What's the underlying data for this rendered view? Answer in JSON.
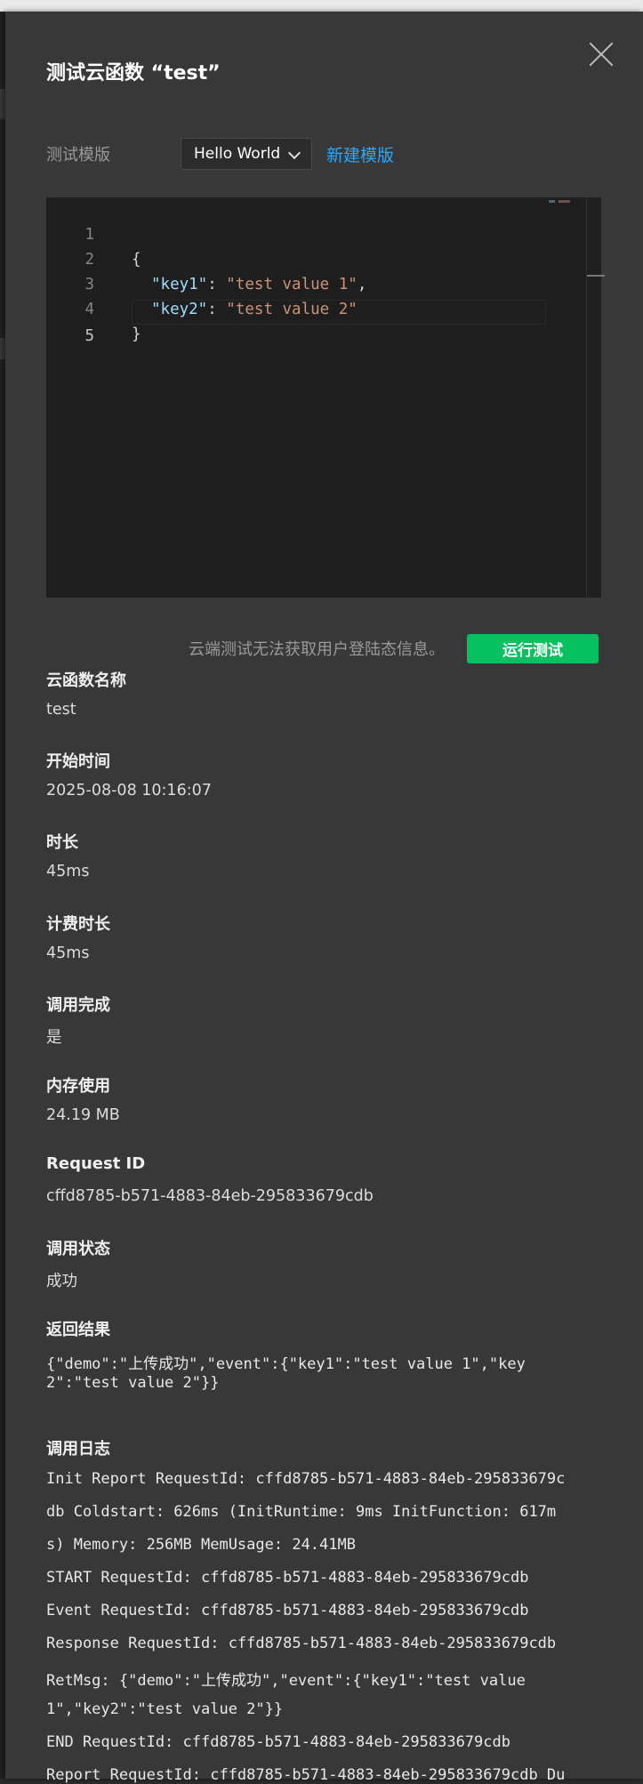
{
  "dialog": {
    "title": "测试云函数 “test”"
  },
  "template": {
    "label": "测试模版",
    "selected": "Hello World",
    "new_link": "新建模版"
  },
  "editor": {
    "lines": [
      {
        "number": "1",
        "parts": [
          "{"
        ]
      },
      {
        "number": "2",
        "parts": [
          "\"key1\"",
          ": ",
          "\"test value 1\"",
          ","
        ]
      },
      {
        "number": "3",
        "parts": [
          "\"key2\"",
          ": ",
          "\"test value 2\""
        ]
      },
      {
        "number": "4",
        "parts": [
          "}"
        ]
      },
      {
        "number": "5",
        "parts": [
          ""
        ]
      }
    ]
  },
  "run": {
    "note": "云端测试无法获取用户登陆态信息。",
    "button": "运行测试"
  },
  "results": {
    "function_name": {
      "label": "云函数名称",
      "value": "test"
    },
    "start_time": {
      "label": "开始时间",
      "value": "2025-08-08 10:16:07"
    },
    "duration": {
      "label": "时长",
      "value": "45ms"
    },
    "billed_duration": {
      "label": "计费时长",
      "value": "45ms"
    },
    "invoke_done": {
      "label": "调用完成",
      "value": "是"
    },
    "memory": {
      "label": "内存使用",
      "value": "24.19 MB"
    },
    "request_id": {
      "label": "Request ID",
      "value": "cffd8785-b571-4883-84eb-295833679cdb"
    },
    "status": {
      "label": "调用状态",
      "value": "成功"
    },
    "return_value": {
      "label": "返回结果",
      "lines": [
        "{\"demo\":\"上传成功\",\"event\":{\"key1\":\"test value 1\",\"key",
        "2\":\"test value 2\"}}"
      ]
    },
    "log": {
      "label": "调用日志",
      "lines": [
        "Init Report RequestId: cffd8785-b571-4883-84eb-295833679c",
        "db Coldstart: 626ms (InitRuntime: 9ms InitFunction: 617m",
        "s) Memory: 256MB MemUsage: 24.41MB",
        "START RequestId: cffd8785-b571-4883-84eb-295833679cdb",
        "Event RequestId: cffd8785-b571-4883-84eb-295833679cdb",
        "Response RequestId: cffd8785-b571-4883-84eb-295833679cdb",
        "RetMsg: {\"demo\":\"上传成功\",\"event\":{\"key1\":\"test value",
        "1\",\"key2\":\"test value 2\"}}",
        "END RequestId: cffd8785-b571-4883-84eb-295833679cdb",
        "Report RequestId: cffd8785-b571-4883-84eb-295833679cdb Du"
      ]
    }
  }
}
